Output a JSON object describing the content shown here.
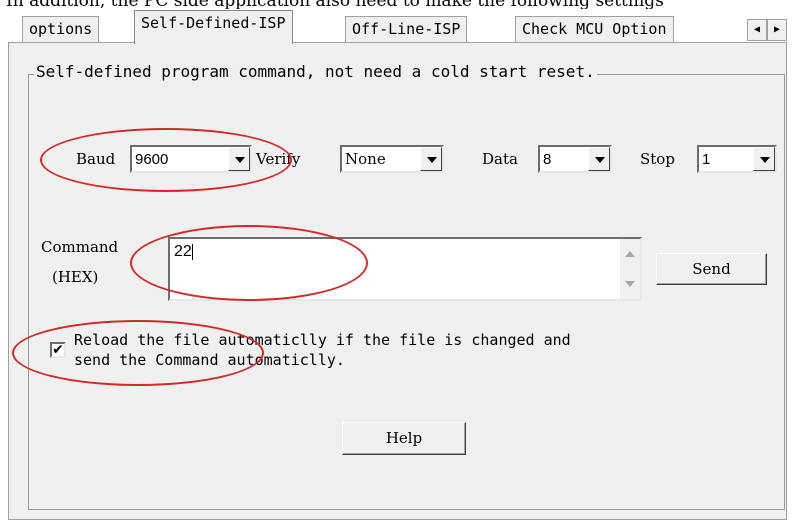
{
  "caption": "In addition, the PC side application also need to make the following settings",
  "tabs": [
    "options",
    "Self-Defined-ISP",
    "Off-Line-ISP",
    "Check MCU Option"
  ],
  "tab_scroll": {
    "left": "◀",
    "right": "▶"
  },
  "group": {
    "legend": "Self-defined program command, not need a cold start reset."
  },
  "baud": {
    "label": "Baud",
    "value": "9600"
  },
  "verify": {
    "label": "Verify",
    "value": "None"
  },
  "data_bits": {
    "label": "Data",
    "value": "8"
  },
  "stop": {
    "label": "Stop",
    "value": "1"
  },
  "command": {
    "label_line1": "Command",
    "label_line2": "(HEX)",
    "value": "22"
  },
  "send_button": "Send",
  "reload": {
    "checked": true,
    "mark": "✔",
    "line1": "Reload the file automaticlly if the file is changed and",
    "line2": "send the Command automaticlly."
  },
  "help_button": "Help",
  "annotation_color": "#d42a2a"
}
